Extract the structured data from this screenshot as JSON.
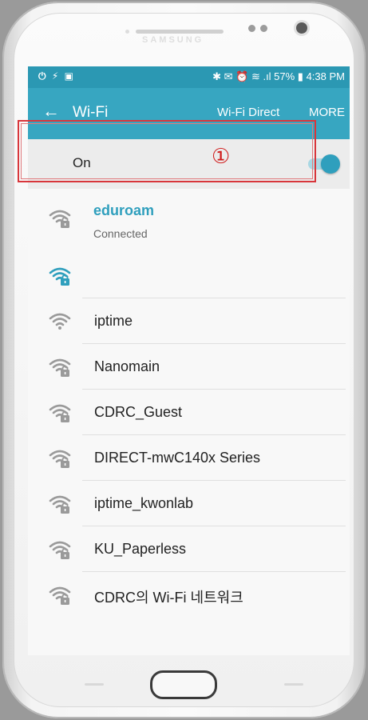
{
  "device": {
    "brand": "SAMSUNG"
  },
  "status_bar": {
    "left_icons": "⏻ ⚡ ▣",
    "right_text": "✱ ✉ ⏰ ≋ .ıl 57% ▮ 4:38 PM",
    "battery": "57%",
    "time": "4:38 PM"
  },
  "app_bar": {
    "title": "Wi-Fi",
    "wifi_direct_label": "Wi-Fi Direct",
    "more_label": "MORE"
  },
  "toggle_row": {
    "label": "On",
    "state": true
  },
  "connected_network": {
    "name": "eduroam",
    "status": "Connected",
    "secured": true
  },
  "annotation": {
    "marker": "①"
  },
  "networks": [
    {
      "name": "",
      "secured": true,
      "highlighted": true
    },
    {
      "name": "iptime",
      "secured": false
    },
    {
      "name": "Nanomain",
      "secured": true
    },
    {
      "name": "CDRC_Guest",
      "secured": true
    },
    {
      "name": "DIRECT-mwC140x Series",
      "secured": true
    },
    {
      "name": "iptime_kwonlab",
      "secured": true
    },
    {
      "name": "KU_Paperless",
      "secured": true
    },
    {
      "name": "CDRC의 Wi-Fi 네트워크",
      "secured": true
    }
  ],
  "colors": {
    "status_bar": "#2b98b3",
    "app_bar": "#37a6c1",
    "accent": "#2f9fbd",
    "wifi_icon_gray": "#9a9a9a",
    "annotation_red": "#d8363b"
  }
}
